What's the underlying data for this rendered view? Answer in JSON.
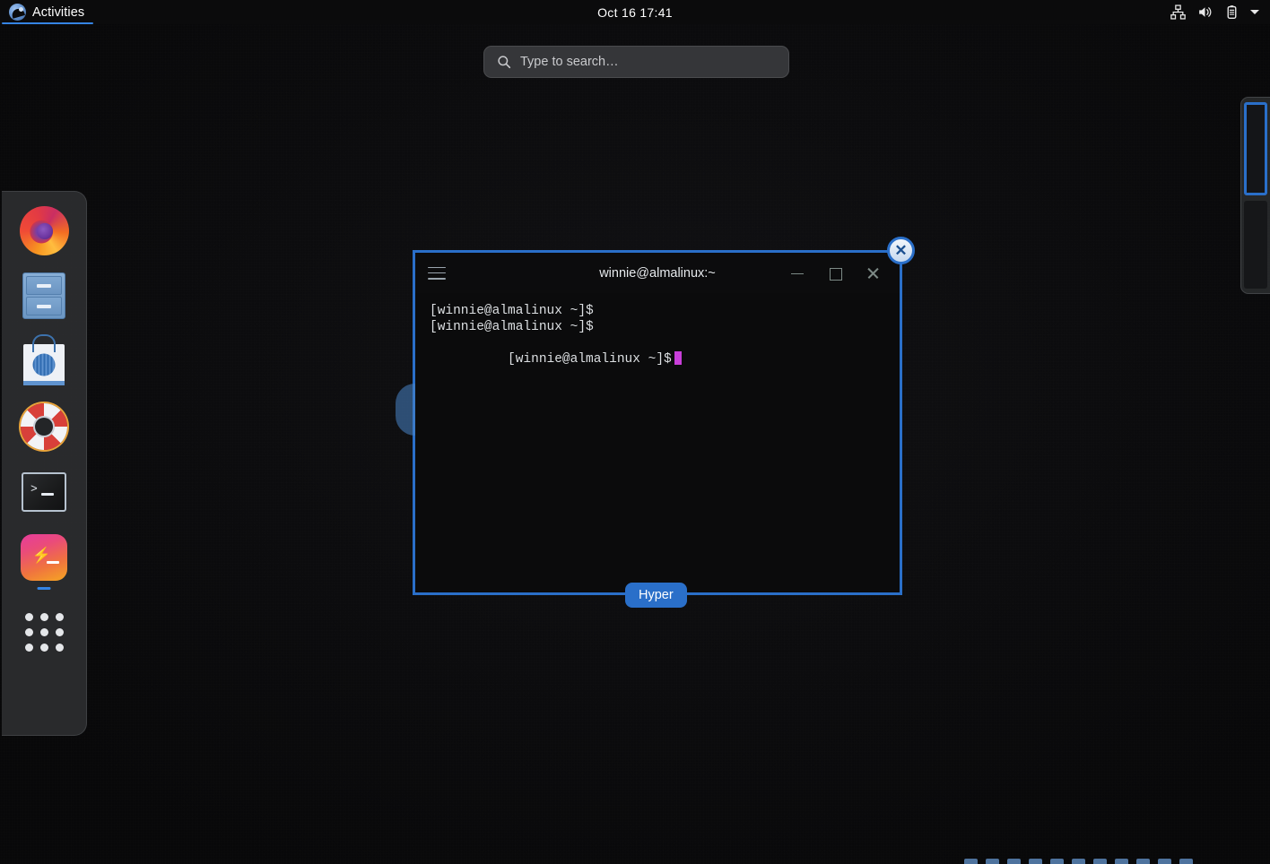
{
  "topbar": {
    "activities_label": "Activities",
    "logo_icon": "gnome-footprint-icon",
    "clock": "Oct 16  17:41",
    "tray": [
      {
        "icon": "network-wired-icon",
        "name": "network-icon"
      },
      {
        "icon": "volume-speaker-icon",
        "name": "volume-icon"
      },
      {
        "icon": "battery-icon",
        "name": "battery-icon"
      },
      {
        "icon": "chevron-down-icon",
        "name": "system-menu-caret-icon"
      }
    ]
  },
  "search": {
    "placeholder": "Type to search…",
    "value": "",
    "icon": "search-icon"
  },
  "dock": {
    "items": [
      {
        "label": "Firefox",
        "icon": "firefox-icon",
        "running": false
      },
      {
        "label": "Files",
        "icon": "files-cabinet-icon",
        "running": false
      },
      {
        "label": "Software",
        "icon": "software-bag-icon",
        "running": false
      },
      {
        "label": "Help",
        "icon": "help-lifering-icon",
        "running": false
      },
      {
        "label": "Terminal",
        "icon": "terminal-icon",
        "running": false
      },
      {
        "label": "Hyper",
        "icon": "hyper-icon",
        "running": true
      },
      {
        "label": "Show Applications",
        "icon": "app-grid-icon",
        "running": false
      }
    ]
  },
  "workspaces": {
    "items": [
      {
        "name": "workspace-1",
        "active": true
      },
      {
        "name": "workspace-2",
        "active": false
      }
    ]
  },
  "window": {
    "overview_label": "Hyper",
    "close_badge_glyph": "✕",
    "title": "winnie@almalinux:~",
    "menu_icon": "hamburger-menu-icon",
    "buttons": {
      "minimize": "minimize-icon",
      "maximize": "maximize-icon",
      "close": "close-icon"
    },
    "terminal": {
      "lines": [
        "[winnie@almalinux ~]$",
        "[winnie@almalinux ~]$",
        "[winnie@almalinux ~]$"
      ],
      "cursor_color": "#c83fd9"
    }
  },
  "colors": {
    "accent_blue": "#2a6fc9",
    "topbar_accent": "#3584e4",
    "desktop_bg": "#0b0b0c",
    "dock_bg": "#2c2e30",
    "search_bg": "#353639"
  }
}
